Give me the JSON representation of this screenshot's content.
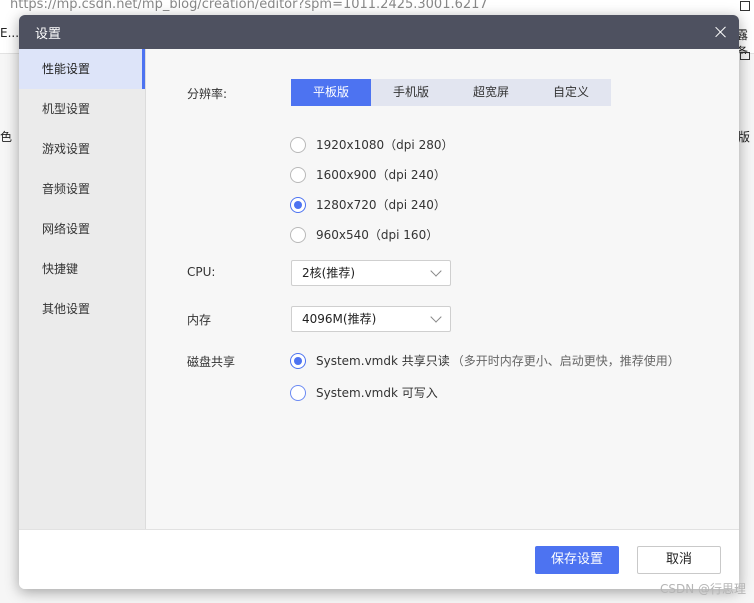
{
  "background": {
    "url": "https://mp.csdn.net/mp_blog/creation/editor?spm=1011.2425.3001.6217",
    "frag_left_1": "E...",
    "frag_left_2": "色",
    "frag_right_1": "露备",
    "frag_right_2": "版"
  },
  "dialog": {
    "title": "设置",
    "sidebar": {
      "items": [
        {
          "label": "性能设置",
          "active": true
        },
        {
          "label": "机型设置"
        },
        {
          "label": "游戏设置"
        },
        {
          "label": "音频设置"
        },
        {
          "label": "网络设置"
        },
        {
          "label": "快捷键"
        },
        {
          "label": "其他设置"
        }
      ]
    },
    "performance": {
      "resolution_label": "分辨率:",
      "tabs": [
        "平板版",
        "手机版",
        "超宽屏",
        "自定义"
      ],
      "active_tab": 0,
      "resolutions": [
        "1920x1080（dpi 280）",
        "1600x900（dpi 240）",
        "1280x720（dpi 240）",
        "960x540（dpi 160）"
      ],
      "selected_resolution": 2,
      "cpu_label": "CPU:",
      "cpu_value": "2核(推荐)",
      "memory_label": "内存",
      "memory_value": "4096M(推荐)",
      "disk_label": "磁盘共享",
      "disk_options": [
        {
          "label": "System.vmdk 共享只读",
          "hint": "（多开时内存更小、启动更快，推荐使用）"
        },
        {
          "label": "System.vmdk 可写入",
          "hint": ""
        }
      ],
      "selected_disk": 0
    },
    "footer": {
      "save_label": "保存设置",
      "cancel_label": "取消"
    }
  },
  "watermark": "CSDN @行思理",
  "colors": {
    "accent": "#4d73f1",
    "titlebar": "#4e5160"
  }
}
